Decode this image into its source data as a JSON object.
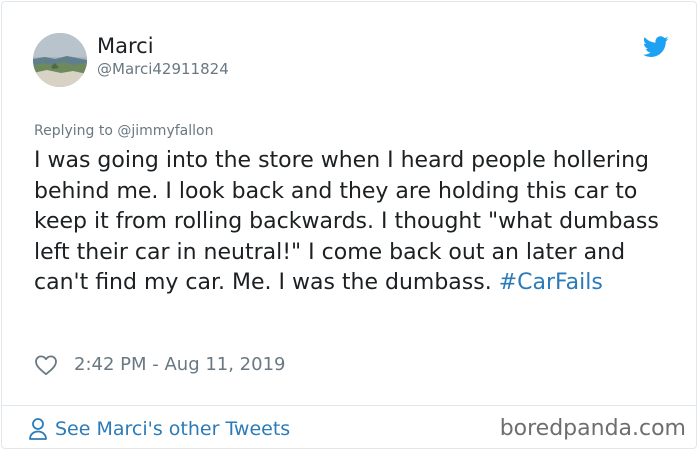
{
  "author": {
    "name": "Marci",
    "handle": "@Marci42911824"
  },
  "reply": {
    "prefix": "Replying to",
    "handle": "@jimmyfallon"
  },
  "tweet": {
    "text": "I was going into the store when I heard people hollering behind me. I look back and they are holding this car to keep it from rolling backwards. I thought \"what dumbass left their car in neutral!\" I come back out an later and can't find my car. Me. I was the dumbass. ",
    "hashtag": "#CarFails"
  },
  "meta": {
    "timestamp": "2:42 PM - Aug 11, 2019"
  },
  "footer": {
    "see_tweets_label": "See Marci's other Tweets",
    "watermark": "boredpanda.com"
  },
  "icons": {
    "brand": "twitter-bird-icon",
    "like": "heart-icon",
    "profile": "person-icon"
  },
  "colors": {
    "link_blue": "#2b7bb9",
    "twitter_blue": "#1da1f2",
    "muted_gray": "#697882",
    "text_dark": "#1c2022",
    "border": "#e1e8ed"
  }
}
